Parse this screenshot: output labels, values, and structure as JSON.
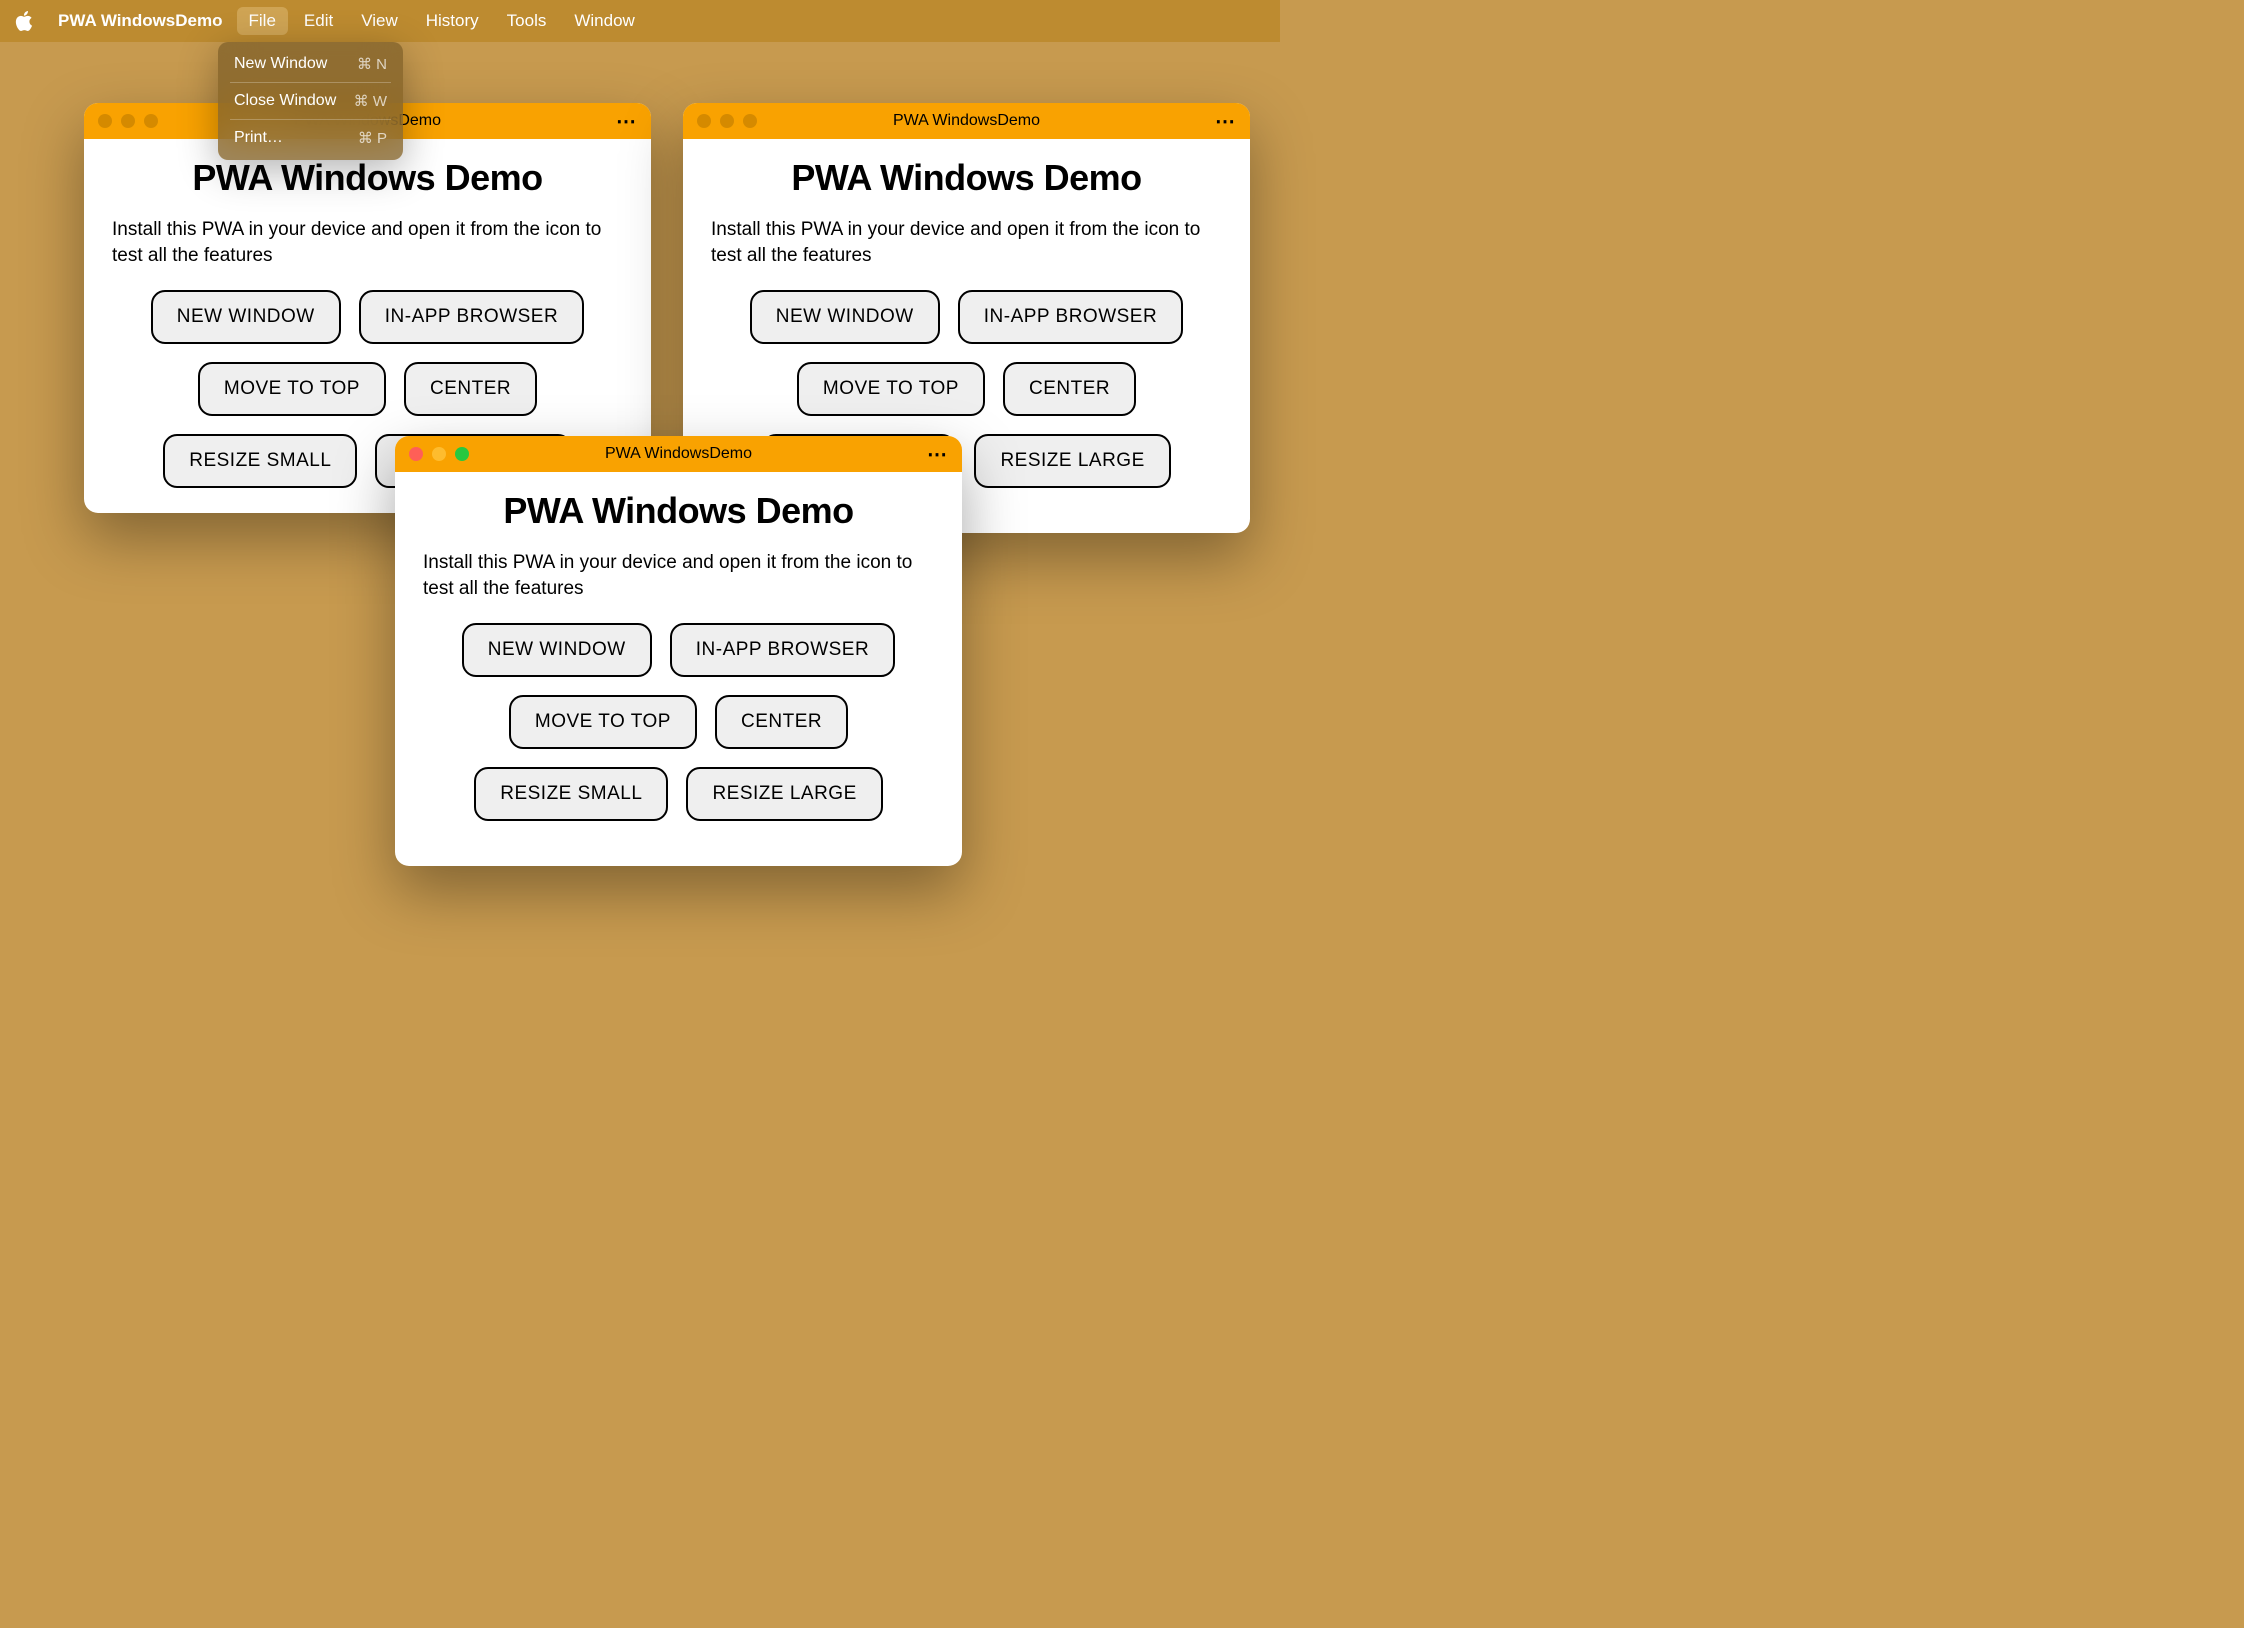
{
  "menubar": {
    "app_name": "PWA WindowsDemo",
    "items": [
      "File",
      "Edit",
      "View",
      "History",
      "Tools",
      "Window"
    ],
    "active_index": 0
  },
  "dropdown": {
    "items": [
      {
        "label": "New Window",
        "shortcut": "⌘ N"
      },
      {
        "label": "Close Window",
        "shortcut": "⌘ W"
      },
      {
        "label": "Print…",
        "shortcut": "⌘ P"
      }
    ]
  },
  "window": {
    "title": "PWA WindowsDemo",
    "heading": "PWA Windows Demo",
    "description": "Install this PWA in your device and open it from the icon to test all the features",
    "buttons": [
      "NEW WINDOW",
      "IN-APP BROWSER",
      "MOVE TO TOP",
      "CENTER",
      "RESIZE SMALL",
      "RESIZE LARGE"
    ]
  }
}
